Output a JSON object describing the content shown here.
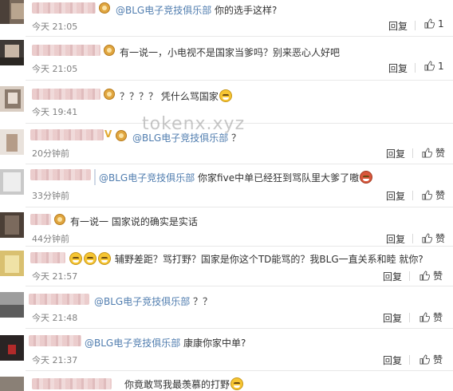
{
  "watermark": "tokenx.xyz",
  "actions": {
    "reply": "回复",
    "like": "赞"
  },
  "comments": [
    {
      "mention": "@BLG电子竞技俱乐部",
      "text": "你的选手这样?",
      "time": "今天 21:05",
      "likes": "1"
    },
    {
      "text": "有一说一，小电视不是国家当爹吗？别来恶心人好吧",
      "time": "今天 21:05",
      "likes": "1"
    },
    {
      "text": "？？？？ 凭什么骂国家",
      "time": "今天 19:41",
      "likes": ""
    },
    {
      "mention": "@BLG电子竞技俱乐部",
      "text": "？",
      "time": "20分钟前",
      "likes": "赞"
    },
    {
      "mention": "@BLG电子竞技俱乐部",
      "text": "你家five中单已经狂到骂队里大爹了嗷",
      "time": "33分钟前",
      "likes": "赞"
    },
    {
      "text": "有一说一 国家说的确实是实话",
      "time": "44分钟前",
      "likes": "赞"
    },
    {
      "text": "辅野差距？骂打野？国家是你这个TD能骂的？我BLG一直关系和睦 就你?",
      "time": "今天 21:57",
      "likes": "赞"
    },
    {
      "mention": "@BLG电子竞技俱乐部",
      "text": "？？",
      "time": "今天 21:48",
      "likes": "赞"
    },
    {
      "mention": "@BLG电子竞技俱乐部",
      "text": "康康你家中单?",
      "time": "今天 21:37",
      "likes": "赞"
    },
    {
      "text": "你竟敢骂我最羡慕的打野",
      "time": "",
      "likes": ""
    }
  ]
}
